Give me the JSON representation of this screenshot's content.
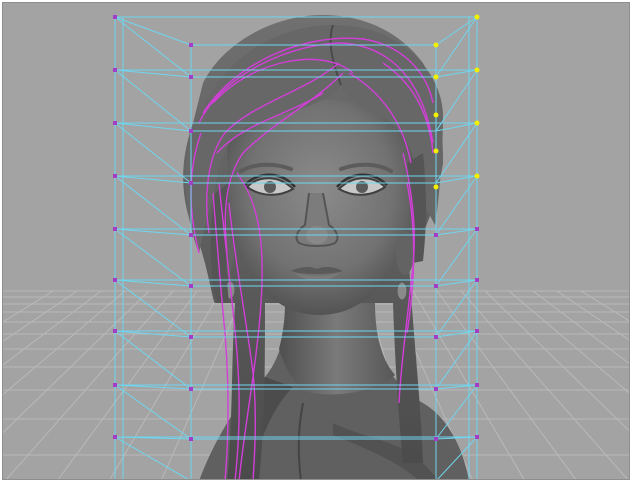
{
  "viewport": {
    "panel": "perspective",
    "background": "#a3a3a3"
  },
  "scene": {
    "model": "female-head-bust",
    "mesh_color": "#6e6e6e",
    "guide_curve_color": "#d23fd8",
    "lattice_color": "#6fd6ef",
    "grid_color": "#b9b9b9",
    "vertex_color_default": "#a33cc6",
    "vertex_color_selected": "#f0f000"
  }
}
